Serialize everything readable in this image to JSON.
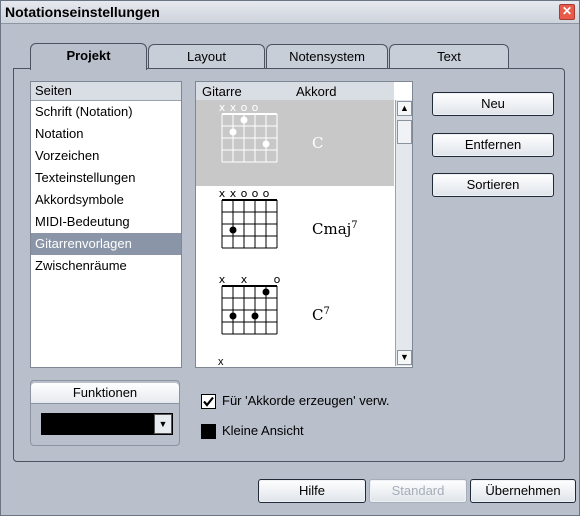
{
  "window": {
    "title": "Notationseinstellungen",
    "close_glyph": "✕"
  },
  "tabs": [
    {
      "label": "Projekt",
      "active": true
    },
    {
      "label": "Layout",
      "active": false
    },
    {
      "label": "Notensystem",
      "active": false
    },
    {
      "label": "Text",
      "active": false
    }
  ],
  "pages": {
    "header": "Seiten",
    "items": [
      {
        "label": "Schrift (Notation)",
        "selected": false
      },
      {
        "label": "Notation",
        "selected": false
      },
      {
        "label": "Vorzeichen",
        "selected": false
      },
      {
        "label": "Texteinstellungen",
        "selected": false
      },
      {
        "label": "Akkordsymbole",
        "selected": false
      },
      {
        "label": "MIDI-Bedeutung",
        "selected": false
      },
      {
        "label": "Gitarrenvorlagen",
        "selected": true
      },
      {
        "label": "Zwischenräume",
        "selected": false
      }
    ]
  },
  "chord_table": {
    "col_guitar": "Gitarre",
    "col_chord": "Akkord",
    "rows": [
      {
        "chord": "C",
        "selected": true,
        "strings": [
          "x",
          "x",
          "o",
          "o",
          "",
          ""
        ],
        "dots": [
          [
            2,
            1
          ],
          [
            1,
            2
          ],
          [
            4,
            3
          ]
        ]
      },
      {
        "chord": "Cmaj",
        "sup": "7",
        "selected": false,
        "strings": [
          "x",
          "x",
          "o",
          "o",
          "o",
          ""
        ],
        "dots": [
          [
            1,
            3
          ]
        ]
      },
      {
        "chord": "C",
        "sup": "7",
        "selected": false,
        "strings": [
          "x",
          "",
          "x",
          "",
          "",
          "o"
        ],
        "dots": [
          [
            4,
            1
          ],
          [
            1,
            3
          ],
          [
            3,
            3
          ]
        ]
      }
    ],
    "partial_row_marker": "x"
  },
  "buttons": {
    "new": "Neu",
    "remove": "Entfernen",
    "sort": "Sortieren"
  },
  "functions": {
    "label": "Funktionen",
    "value": ""
  },
  "options": {
    "use_for_create": {
      "label": "Für 'Akkorde erzeugen' verw.",
      "checked": true
    },
    "small_view": {
      "label": "Kleine Ansicht",
      "checked": false
    }
  },
  "footer": {
    "help": "Hilfe",
    "default": "Standard",
    "apply": "Übernehmen"
  }
}
